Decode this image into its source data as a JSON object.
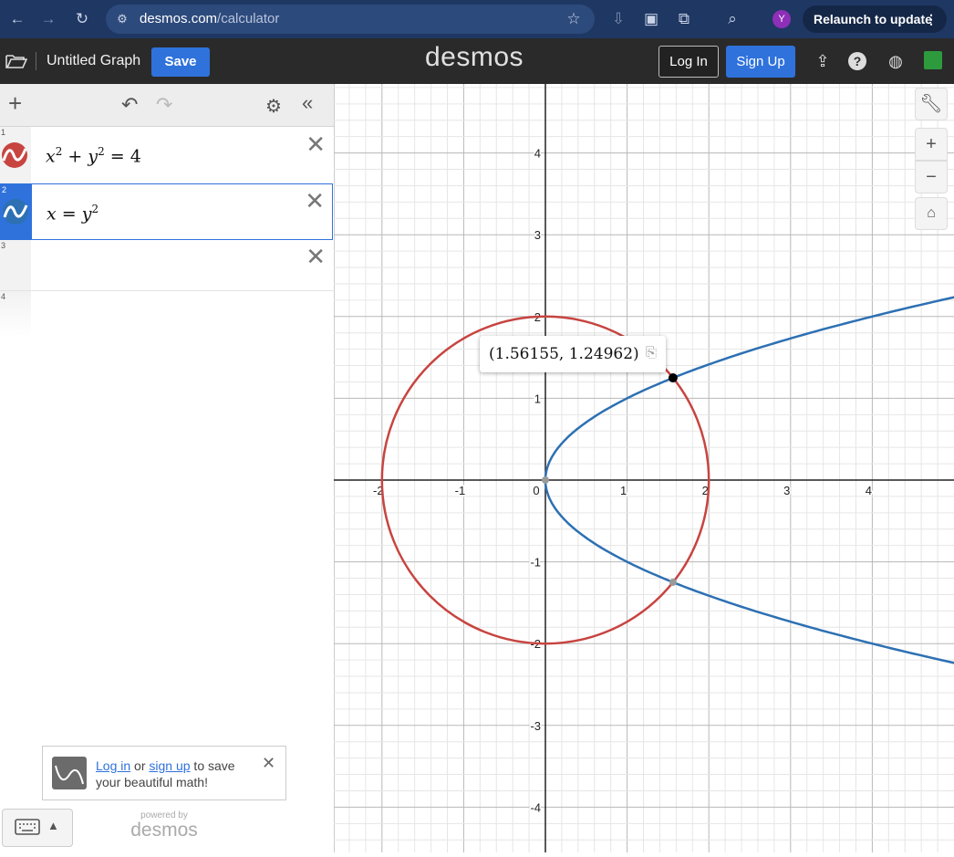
{
  "browser": {
    "url_host": "desmos.com",
    "url_path": "/calculator",
    "profile_initial": "Y",
    "relaunch_label": "Relaunch to update"
  },
  "header": {
    "graph_title": "Untitled Graph",
    "save_label": "Save",
    "logo_text": "desmos",
    "login_label": "Log In",
    "signup_label": "Sign Up"
  },
  "expressions": [
    {
      "number": "1",
      "latex_base": "x",
      "latex_rest": "2 + y",
      "color": "#c74440",
      "type": "circle"
    },
    {
      "number": "2",
      "color": "#2d70b3"
    },
    {
      "number": "3"
    },
    {
      "number": "4"
    }
  ],
  "expr1": {
    "a": "x",
    "a_exp": "2",
    "plus": " + ",
    "b": "y",
    "b_exp": "2",
    "rhs": " = 4"
  },
  "expr2": {
    "a": "x",
    "eq": " = ",
    "b": "y",
    "b_exp": "2"
  },
  "login_prompt": {
    "login_link": "Log in",
    "or": " or ",
    "signup_link": "sign up",
    "rest": " to save your beautiful math!"
  },
  "powered_by": {
    "line1": "powered by",
    "line2": "desmos"
  },
  "tooltip": {
    "text": "(1.56155, 1.24962)"
  },
  "graph_colors": {
    "circle": "#c74440",
    "parabola": "#2d70b3",
    "axis": "#222222"
  },
  "chart_data": {
    "type": "line",
    "title": "",
    "xlabel": "",
    "ylabel": "",
    "xlim": [
      -2.6,
      5
    ],
    "ylim": [
      -4.5,
      4.9
    ],
    "x_ticks": [
      "-2",
      "-1",
      "0",
      "1",
      "2",
      "3",
      "4"
    ],
    "y_ticks": [
      "4",
      "3",
      "2",
      "1",
      "-1",
      "-2",
      "-3",
      "-4"
    ],
    "grid": true,
    "series": [
      {
        "equation": "x^2 + y^2 = 4",
        "color": "#c74440"
      },
      {
        "equation": "x = y^2",
        "color": "#2d70b3"
      }
    ],
    "highlighted_point": {
      "x": 1.56155,
      "y": 1.24962
    },
    "intersection_points": [
      {
        "x": 1.56155,
        "y": 1.24962
      },
      {
        "x": 1.56155,
        "y": -1.24962
      },
      {
        "x": 0,
        "y": 0
      }
    ]
  }
}
